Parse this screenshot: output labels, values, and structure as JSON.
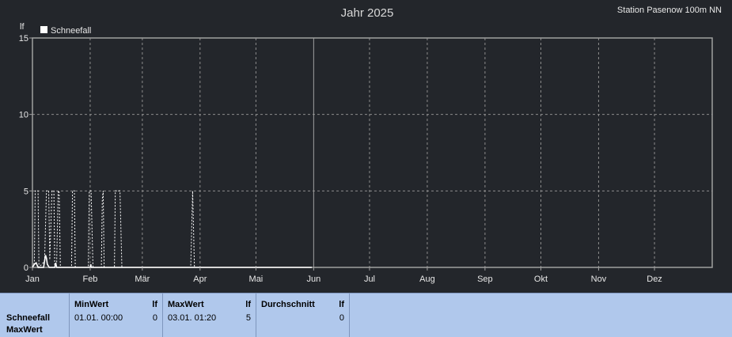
{
  "title": "Jahr 2025",
  "station": "Station Pasenow 100m NN",
  "unit_label": "lf",
  "legend": {
    "label": "Schneefall",
    "color": "#ffffff"
  },
  "colors": {
    "background": "#23262b",
    "grid": "#8c8c8c",
    "axis": "#a0a0a0",
    "series": "#ffffff",
    "stats_bg": "#b0c8ec"
  },
  "chart_data": {
    "type": "line",
    "title": "Jahr 2025",
    "ylabel": "lf",
    "xlabel": "",
    "ylim": [
      0,
      15
    ],
    "yticks": [
      0,
      5,
      10,
      15
    ],
    "xlim": [
      0,
      365
    ],
    "xticks": [
      {
        "label": "Jan",
        "day": 0
      },
      {
        "label": "Feb",
        "day": 31
      },
      {
        "label": "Mär",
        "day": 59
      },
      {
        "label": "Apr",
        "day": 90
      },
      {
        "label": "Mai",
        "day": 120
      },
      {
        "label": "Jun",
        "day": 151
      },
      {
        "label": "Jul",
        "day": 181
      },
      {
        "label": "Aug",
        "day": 212
      },
      {
        "label": "Sep",
        "day": 243
      },
      {
        "label": "Okt",
        "day": 273
      },
      {
        "label": "Nov",
        "day": 304
      },
      {
        "label": "Dez",
        "day": 334
      }
    ],
    "grid": true,
    "legend_position": "top-left",
    "series": [
      {
        "name": "Schneefall",
        "style": "dotted",
        "points": [
          [
            0,
            0
          ],
          [
            1,
            0.3
          ],
          [
            1.5,
            5
          ],
          [
            3,
            5
          ],
          [
            3.5,
            0
          ],
          [
            5,
            0.2
          ],
          [
            6.5,
            0.4
          ],
          [
            7.5,
            5
          ],
          [
            8.7,
            5
          ],
          [
            9.3,
            0.5
          ],
          [
            10.5,
            5
          ],
          [
            11.5,
            5
          ],
          [
            12,
            0
          ],
          [
            13,
            0.3
          ],
          [
            13.8,
            5
          ],
          [
            14.3,
            5
          ],
          [
            15,
            0
          ],
          [
            21,
            0
          ],
          [
            21.5,
            5
          ],
          [
            22.5,
            5
          ],
          [
            23,
            0
          ],
          [
            30,
            0
          ],
          [
            30.5,
            5
          ],
          [
            31.5,
            5
          ],
          [
            32.5,
            0
          ],
          [
            37,
            0
          ],
          [
            37.5,
            4.5
          ],
          [
            38,
            5
          ],
          [
            38.5,
            0
          ],
          [
            44,
            0
          ],
          [
            44.5,
            5
          ],
          [
            47,
            5
          ],
          [
            48,
            0
          ],
          [
            85,
            0
          ],
          [
            86,
            5
          ],
          [
            87,
            0
          ],
          [
            150,
            0
          ]
        ]
      },
      {
        "name": "Schneefall",
        "style": "solid",
        "points": [
          [
            0,
            0
          ],
          [
            1,
            0.2
          ],
          [
            2,
            0.3
          ],
          [
            3,
            0
          ],
          [
            6,
            0
          ],
          [
            7,
            0.8
          ],
          [
            7.5,
            0.6
          ],
          [
            8,
            0.2
          ],
          [
            9,
            0
          ],
          [
            12,
            0
          ],
          [
            12.5,
            0.3
          ],
          [
            13,
            0
          ],
          [
            31,
            0
          ],
          [
            31.3,
            0.2
          ],
          [
            31.6,
            0
          ],
          [
            150,
            0
          ]
        ]
      }
    ]
  },
  "stats": {
    "row_label_1": "Schneefall",
    "row_label_2": "MaxWert",
    "columns": [
      {
        "header": "MinWert",
        "unit": "lf",
        "date": "01.01.  00:00",
        "value": "0"
      },
      {
        "header": "MaxWert",
        "unit": "lf",
        "date": "03.01.  01:20",
        "value": "5"
      },
      {
        "header": "Durchschnitt",
        "unit": "lf",
        "date": "",
        "value": "0"
      }
    ]
  }
}
